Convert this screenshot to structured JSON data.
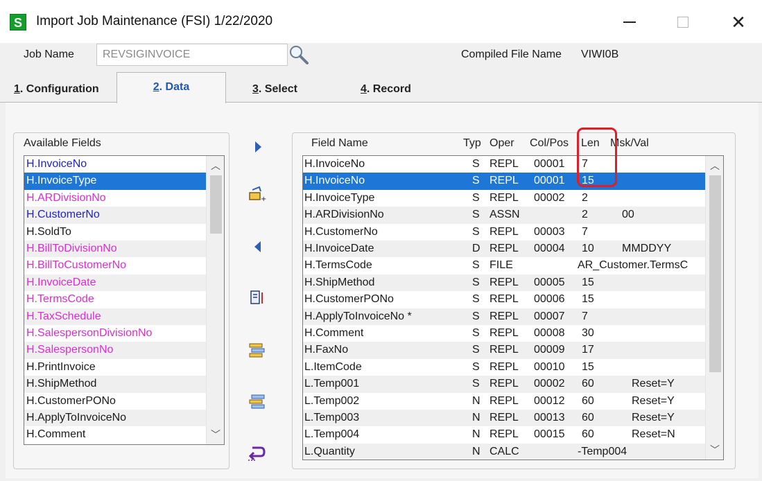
{
  "window": {
    "app_icon": "S",
    "title": "Import Job Maintenance (FSI) 1/22/2020",
    "close_glyph": "✕"
  },
  "job": {
    "label": "Job Name",
    "value": "REVSIGINVOICE",
    "compiled_label": "Compiled File Name",
    "compiled_value": "VIWI0B"
  },
  "tabs": [
    {
      "num": "1",
      "label": ". Configuration"
    },
    {
      "num": "2",
      "label": ". Data"
    },
    {
      "num": "3",
      "label": ". Select"
    },
    {
      "num": "4",
      "label": ". Record"
    }
  ],
  "available": {
    "header": "Available Fields",
    "items": [
      {
        "label": "H.InvoiceNo",
        "color": "blue"
      },
      {
        "label": "H.InvoiceType",
        "color": "blue",
        "selected": true
      },
      {
        "label": "H.ARDivisionNo",
        "color": "magenta"
      },
      {
        "label": "H.CustomerNo",
        "color": "blue"
      },
      {
        "label": "H.SoldTo",
        "color": "black"
      },
      {
        "label": "H.BillToDivisionNo",
        "color": "magenta"
      },
      {
        "label": "H.BillToCustomerNo",
        "color": "magenta"
      },
      {
        "label": "H.InvoiceDate",
        "color": "magenta"
      },
      {
        "label": "H.TermsCode",
        "color": "magenta"
      },
      {
        "label": "H.TaxSchedule",
        "color": "magenta"
      },
      {
        "label": "H.SalespersonDivisionNo",
        "color": "magenta"
      },
      {
        "label": "H.SalespersonNo",
        "color": "magenta"
      },
      {
        "label": "H.PrintInvoice",
        "color": "black"
      },
      {
        "label": "H.ShipMethod",
        "color": "black"
      },
      {
        "label": "H.CustomerPONo",
        "color": "black"
      },
      {
        "label": "H.ApplyToInvoiceNo",
        "color": "black"
      },
      {
        "label": "H.Comment",
        "color": "black"
      }
    ]
  },
  "fields": {
    "headers": {
      "name": "Field Name",
      "typ": "Typ",
      "oper": "Oper",
      "colpos": "Col/Pos",
      "len": "Len",
      "mask": "Msk/Val"
    },
    "rows": [
      {
        "name": "H.InvoiceNo",
        "typ": "S",
        "oper": "REPL",
        "col": "00001",
        "len": "7",
        "mask": ""
      },
      {
        "name": "H.InvoiceNo",
        "typ": "S",
        "oper": "REPL",
        "col": "00001",
        "len": "15",
        "mask": "",
        "selected": true
      },
      {
        "name": "H.InvoiceType",
        "typ": "S",
        "oper": "REPL",
        "col": "00002",
        "len": "2",
        "mask": ""
      },
      {
        "name": "H.ARDivisionNo",
        "typ": "S",
        "oper": "ASSN",
        "col": "",
        "len": "2",
        "mask": "00"
      },
      {
        "name": "H.CustomerNo",
        "typ": "S",
        "oper": "REPL",
        "col": "00003",
        "len": "7",
        "mask": ""
      },
      {
        "name": "H.InvoiceDate",
        "typ": "D",
        "oper": "REPL",
        "col": "00004",
        "len": "10",
        "mask": "MMDDYY"
      },
      {
        "name": "H.TermsCode",
        "typ": "S",
        "oper": "FILE",
        "col": "",
        "len": "",
        "mask": "AR_Customer.TermsC"
      },
      {
        "name": "H.ShipMethod",
        "typ": "S",
        "oper": "REPL",
        "col": "00005",
        "len": "15",
        "mask": ""
      },
      {
        "name": "H.CustomerPONo",
        "typ": "S",
        "oper": "REPL",
        "col": "00006",
        "len": "15",
        "mask": ""
      },
      {
        "name": "H.ApplyToInvoiceNo *",
        "typ": "S",
        "oper": "REPL",
        "col": "00007",
        "len": "7",
        "mask": ""
      },
      {
        "name": "H.Comment",
        "typ": "S",
        "oper": "REPL",
        "col": "00008",
        "len": "30",
        "mask": ""
      },
      {
        "name": "H.FaxNo",
        "typ": "S",
        "oper": "REPL",
        "col": "00009",
        "len": "17",
        "mask": ""
      },
      {
        "name": "L.ItemCode",
        "typ": "S",
        "oper": "REPL",
        "col": "00010",
        "len": "15",
        "mask": ""
      },
      {
        "name": "L.Temp001",
        "typ": "S",
        "oper": "REPL",
        "col": "00002",
        "len": "60",
        "mask": "Reset=Y"
      },
      {
        "name": "L.Temp002",
        "typ": "N",
        "oper": "REPL",
        "col": "00012",
        "len": "60",
        "mask": "Reset=Y"
      },
      {
        "name": "L.Temp003",
        "typ": "N",
        "oper": "REPL",
        "col": "00013",
        "len": "60",
        "mask": "Reset=Y"
      },
      {
        "name": "L.Temp004",
        "typ": "N",
        "oper": "REPL",
        "col": "00015",
        "len": "60",
        "mask": "Reset=N"
      },
      {
        "name": "L.Quantity",
        "typ": "N",
        "oper": "CALC",
        "col": "",
        "len": "",
        "mask": "-Temp004"
      }
    ]
  },
  "colors": {
    "selection": "#1e76d6",
    "blue_field": "#2222c8",
    "magenta_field": "#e02ad6",
    "highlight": "#e21d25"
  }
}
